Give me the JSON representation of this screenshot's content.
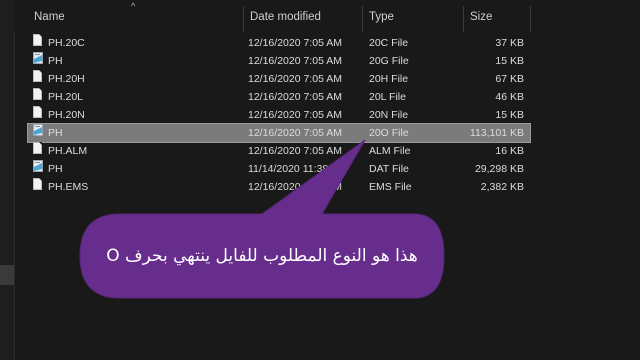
{
  "columns": {
    "name": "Name",
    "date": "Date modified",
    "type": "Type",
    "size": "Size"
  },
  "files": [
    {
      "name": "PH.20C",
      "date": "12/16/2020 7:05 AM",
      "type": "20C File",
      "size": "37 KB",
      "icon": "file-icon"
    },
    {
      "name": "PH",
      "date": "12/16/2020 7:05 AM",
      "type": "20G File",
      "size": "15 KB",
      "icon": "app-icon"
    },
    {
      "name": "PH.20H",
      "date": "12/16/2020 7:05 AM",
      "type": "20H File",
      "size": "67 KB",
      "icon": "file-icon"
    },
    {
      "name": "PH.20L",
      "date": "12/16/2020 7:05 AM",
      "type": "20L File",
      "size": "46 KB",
      "icon": "file-icon"
    },
    {
      "name": "PH.20N",
      "date": "12/16/2020 7:05 AM",
      "type": "20N File",
      "size": "15 KB",
      "icon": "file-icon"
    },
    {
      "name": "PH",
      "date": "12/16/2020 7:05 AM",
      "type": "20O File",
      "size": "113,101 KB",
      "icon": "app-icon",
      "selected": true
    },
    {
      "name": "PH.ALM",
      "date": "12/16/2020 7:05 AM",
      "type": "ALM File",
      "size": "16 KB",
      "icon": "file-icon"
    },
    {
      "name": "PH",
      "date": "11/14/2020 11:38 AM",
      "type": "DAT File",
      "size": "29,298 KB",
      "icon": "app-icon"
    },
    {
      "name": "PH.EMS",
      "date": "12/16/2020 7:05 AM",
      "type": "EMS File",
      "size": "2,382 KB",
      "icon": "file-icon"
    }
  ],
  "callout": {
    "text": "هذا هو النوع المطلوب للفايل ينتهي بحرف O",
    "color": "#662d8c"
  },
  "colors": {
    "background": "#191919",
    "selected_row": "#7b7b7b"
  }
}
